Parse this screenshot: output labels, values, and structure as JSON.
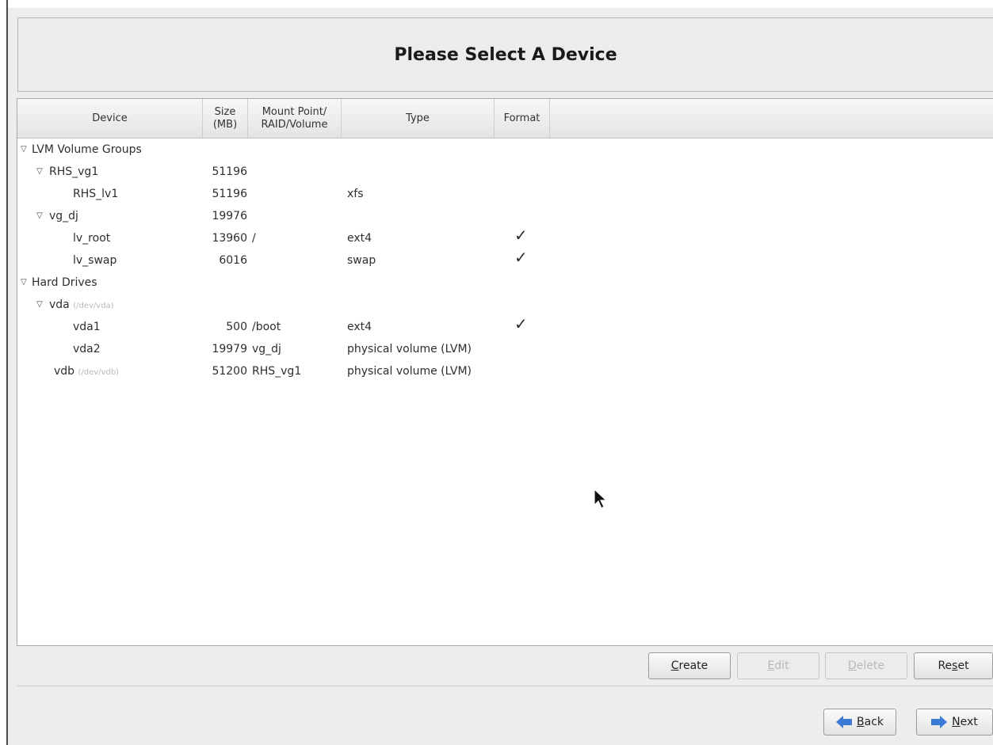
{
  "header": {
    "title": "Please Select A Device"
  },
  "table": {
    "columns": {
      "device": "Device",
      "size": "Size\n(MB)",
      "mount": "Mount Point/\nRAID/Volume",
      "type": "Type",
      "format": "Format"
    },
    "rows": [
      {
        "device": "LVM Volume Groups",
        "size": "",
        "mount": "",
        "type": "",
        "format": ""
      },
      {
        "device": "RHS_vg1",
        "size": "51196",
        "mount": "",
        "type": "",
        "format": ""
      },
      {
        "device": "RHS_lv1",
        "size": "51196",
        "mount": "",
        "type": "xfs",
        "format": ""
      },
      {
        "device": "vg_dj",
        "size": "19976",
        "mount": "",
        "type": "",
        "format": ""
      },
      {
        "device": "lv_root",
        "size": "13960",
        "mount": "/",
        "type": "ext4",
        "format": "✓"
      },
      {
        "device": "lv_swap",
        "size": "6016",
        "mount": "",
        "type": "swap",
        "format": "✓"
      },
      {
        "device": "Hard Drives",
        "size": "",
        "mount": "",
        "type": "",
        "format": ""
      },
      {
        "device": "vda",
        "path": "(/dev/vda)",
        "size": "",
        "mount": "",
        "type": "",
        "format": ""
      },
      {
        "device": "vda1",
        "size": "500",
        "mount": "/boot",
        "type": "ext4",
        "format": "✓"
      },
      {
        "device": "vda2",
        "size": "19979",
        "mount": "vg_dj",
        "type": "physical volume (LVM)",
        "format": ""
      },
      {
        "device": "vdb",
        "path": "(/dev/vdb)",
        "size": "51200",
        "mount": "RHS_vg1",
        "type": "physical volume (LVM)",
        "format": ""
      }
    ]
  },
  "actions": {
    "create": {
      "acc": "C",
      "rest": "reate"
    },
    "edit": {
      "acc": "E",
      "rest": "dit"
    },
    "delete": {
      "acc": "D",
      "rest": "elete"
    },
    "reset": {
      "pre": "Re",
      "acc": "s",
      "rest": "et"
    }
  },
  "nav": {
    "back": {
      "acc": "B",
      "rest": "ack"
    },
    "next": {
      "acc": "N",
      "rest": "ext"
    }
  },
  "icons": {
    "expander": "triangle-down",
    "back": "arrow-left",
    "next": "arrow-right",
    "pointer": "mouse-pointer"
  },
  "colors": {
    "arrow_blue": "#3d7ad6",
    "disabled_text": "#b8b8b8"
  }
}
